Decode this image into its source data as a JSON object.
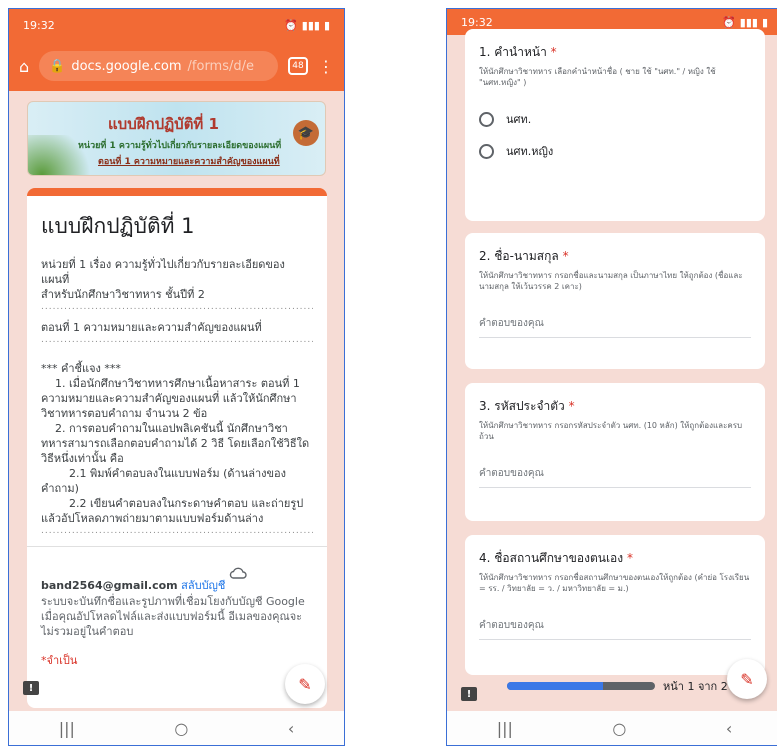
{
  "left": {
    "status": {
      "time": "19:32"
    },
    "urlbar": {
      "domain": "docs.google.com",
      "path": "/forms/d/e",
      "tab_count": "48"
    },
    "banner": {
      "title": "แบบฝึกปฏิบัติที่ 1",
      "unit": "หน่วยที่ 1 ความรู้ทั่วไปเกี่ยวกับรายละเอียดของแผนที่",
      "section": "ตอนที่ 1 ความหมายและความสำคัญของแผนที่"
    },
    "form": {
      "title": "แบบฝึกปฏิบัติที่ 1",
      "line1": "หน่วยที่ 1 เรื่อง ความรู้ทั่วไปเกี่ยวกับรายละเอียดของแผนที่",
      "line2": "สำหรับนักศึกษาวิชาทหาร ชั้นปีที่ 2",
      "dots": "...........................................................................",
      "line3": "ตอนที่ 1 ความหมายและความสำคัญของแผนที่",
      "instr_head": "*** คำชี้แจง ***",
      "instr1": "1. เมื่อนักศึกษาวิชาทหารศึกษาเนื้อหาสาระ ตอนที่ 1 ความหมายและความสำคัญของแผนที่ แล้วให้นักศึกษาวิชาทหารตอบคำถาม จำนวน 2 ข้อ",
      "instr2": "2. การตอบคำถามในแอปพลิเคชันนี้ นักศึกษาวิชาทหารสามารถเลือกตอบคำถามได้ 2 วิธี โดยเลือกใช้วิธีใดวิธีหนึ่งเท่านั้น คือ",
      "instr21": "2.1 พิมพ์คำตอบลงในแบบฟอร์ม (ด้านล่างของคำถาม)",
      "instr22": "2.2 เขียนคำตอบลงในกระดาษคำตอบ และถ่ายรูป แล้วอัปโหลดภาพถ่ายมาตามแบบฟอร์มด้านล่าง",
      "email": "band2564@gmail.com",
      "switch_account": "สลับบัญชี",
      "note": "ระบบจะบันทึกชื่อและรูปภาพที่เชื่อมโยงกับบัญชี Google เมื่อคุณอัปโหลดไฟล์และส่งแบบฟอร์มนี้ อีเมลของคุณจะไม่รวมอยู่ในคำตอบ",
      "required": "*จำเป็น"
    }
  },
  "right": {
    "status": {
      "time": "19:32"
    },
    "q1": {
      "title": "1. คำนำหน้า",
      "star": "*",
      "help": "ให้นักศึกษาวิชาทหาร เลือกคำนำหน้าชื่อ ( ชาย ใช้ \"นศท.\" / หญิง ใช้ \"นศท.หญิง\" )",
      "options": [
        "นศท.",
        "นศท.หญิง"
      ]
    },
    "q2": {
      "title": "2. ชื่อ-นามสกุล",
      "star": "*",
      "help": "ให้นักศึกษาวิชาทหาร กรอกชื่อและนามสกุล เป็นภาษาไทย ให้ถูกต้อง (ชื่อและนามสกุล ให้เว้นวรรค 2 เคาะ)",
      "placeholder": "คำตอบของคุณ"
    },
    "q3": {
      "title": "3. รหัสประจำตัว",
      "star": "*",
      "help": "ให้นักศึกษาวิชาทหาร กรอกรหัสประจำตัว นศท. (10 หลัก) ให้ถูกต้องและครบถ้วน",
      "placeholder": "คำตอบของคุณ"
    },
    "q4": {
      "title": "4. ชื่อสถานศึกษาของตนเอง",
      "star": "*",
      "help": "ให้นักศึกษาวิชาทหาร กรอกชื่อสถานศึกษาของตนเองให้ถูกต้อง (คำย่อ โรงเรียน = รร. / วิทยาลัย = ว. / มหาวิทยาลัย = ม.)",
      "placeholder": "คำตอบของคุณ"
    },
    "progress": {
      "label": "หน้า 1 จาก 2",
      "fraction": 0.65
    }
  },
  "colors": {
    "accent": "#f26a35",
    "background": "#f6dcd5",
    "link": "#1a73e8",
    "required": "#d93025"
  },
  "nav": {
    "recents": "|||",
    "home": "○",
    "back": "‹"
  }
}
